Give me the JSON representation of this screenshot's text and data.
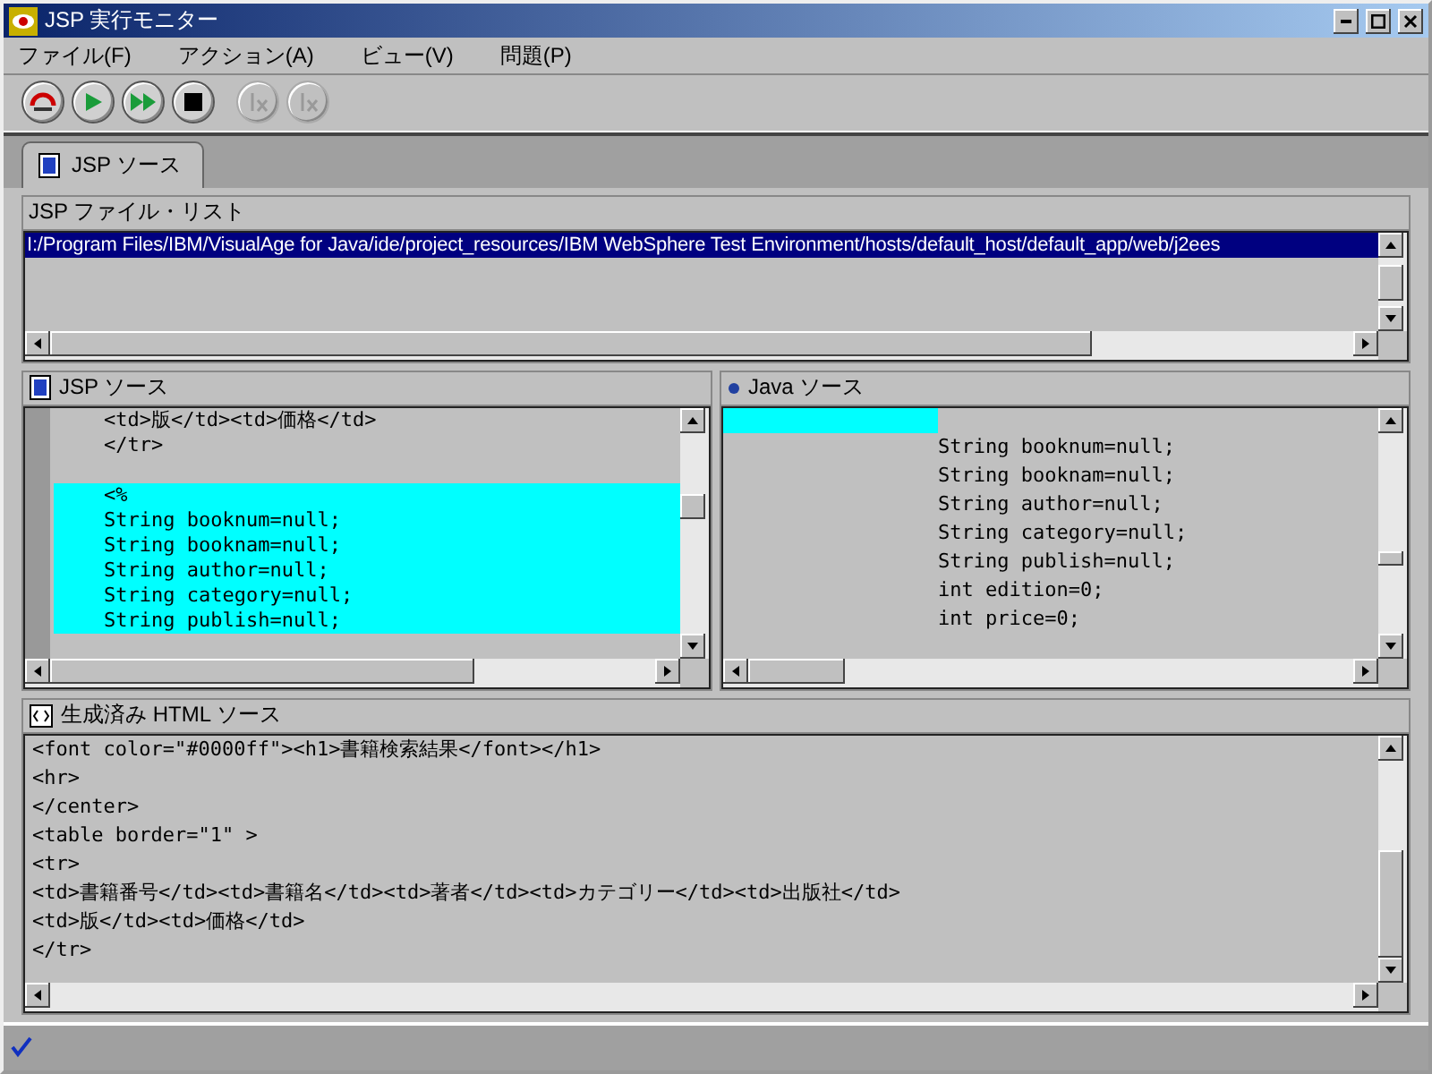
{
  "window": {
    "title": "JSP 実行モニター"
  },
  "menu": [
    "ファイル(F)",
    "アクション(A)",
    "ビュー(V)",
    "問題(P)"
  ],
  "toolbar": [
    {
      "kind": "reload",
      "disabled": false
    },
    {
      "kind": "play",
      "disabled": false
    },
    {
      "kind": "fast",
      "disabled": false
    },
    {
      "kind": "stop",
      "disabled": false
    },
    {
      "kind": "fx",
      "disabled": true
    },
    {
      "kind": "fx",
      "disabled": true
    }
  ],
  "tabs": [
    {
      "label": "JSP ソース",
      "selected": true
    }
  ],
  "file_list": {
    "title": "JSP ファイル・リスト",
    "items": [
      {
        "text": "I:/Program Files/IBM/VisualAge for Java/ide/project_resources/IBM WebSphere Test Environment/hosts/default_host/default_app/web/j2ees",
        "selected": true
      }
    ]
  },
  "jsp_source": {
    "title": "JSP ソース",
    "lines": [
      {
        "text": "<td>版</td><td>価格</td>",
        "highlighted": false
      },
      {
        "text": "</tr>",
        "highlighted": false
      },
      {
        "text": "<%",
        "highlighted": true,
        "gap_before": true
      },
      {
        "text": "String booknum=null;",
        "highlighted": true
      },
      {
        "text": "String booknam=null;",
        "highlighted": true
      },
      {
        "text": "String author=null;",
        "highlighted": true
      },
      {
        "text": "String category=null;",
        "highlighted": true
      },
      {
        "text": "String publish=null;",
        "highlighted": true
      }
    ]
  },
  "java_source": {
    "title": "Java ソース",
    "highlight_bar": true,
    "lines": [
      "String booknum=null;",
      "String booknam=null;",
      "String author=null;",
      "String category=null;",
      "String publish=null;",
      "int edition=0;",
      "int price=0;"
    ]
  },
  "html_source": {
    "title": "生成済み HTML ソース",
    "lines": [
      "<font color=\"#0000ff\"><h1>書籍検索結果</font></h1>",
      "<hr>",
      "</center>",
      "<table border=\"1\" >",
      "<tr>",
      "<td>書籍番号</td><td>書籍名</td><td>著者</td><td>カテゴリー</td><td>出版社</td>",
      "<td>版</td><td>価格</td>",
      "</tr>"
    ]
  },
  "status_bar": {
    "ok": true
  }
}
